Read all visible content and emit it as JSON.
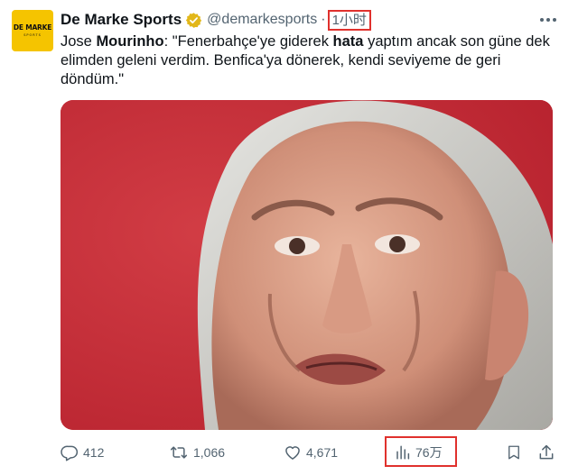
{
  "account": {
    "display_name": "De Marke Sports",
    "handle": "@demarkesports",
    "separator": "·",
    "time": "1小时",
    "avatar_text": "DE MARKE",
    "avatar_subtext": "SPORTS"
  },
  "tweet": {
    "speaker_prefix": "Jose ",
    "speaker_bold": "Mourinho",
    "text_part1": ": \"Fenerbahçe'ye giderek ",
    "text_bold": "hata",
    "text_part2": " yaptım ancak son güne dek elimden geleni verdim. Benfica'ya dönerek, kendi seviyeme de geri döndüm.\""
  },
  "stats": {
    "replies": "412",
    "reposts": "1,066",
    "likes": "4,671",
    "views": "76万"
  },
  "icons": [
    "verified-badge-icon",
    "more-icon",
    "reply-icon",
    "repost-icon",
    "like-icon",
    "views-icon",
    "bookmark-icon",
    "share-icon"
  ],
  "colors": {
    "accent_highlight": "#e0312d",
    "verified_gold": "#e2b719",
    "avatar_bg": "#f5c400",
    "secondary_text": "#536471",
    "photo_background": "#c8303b"
  }
}
